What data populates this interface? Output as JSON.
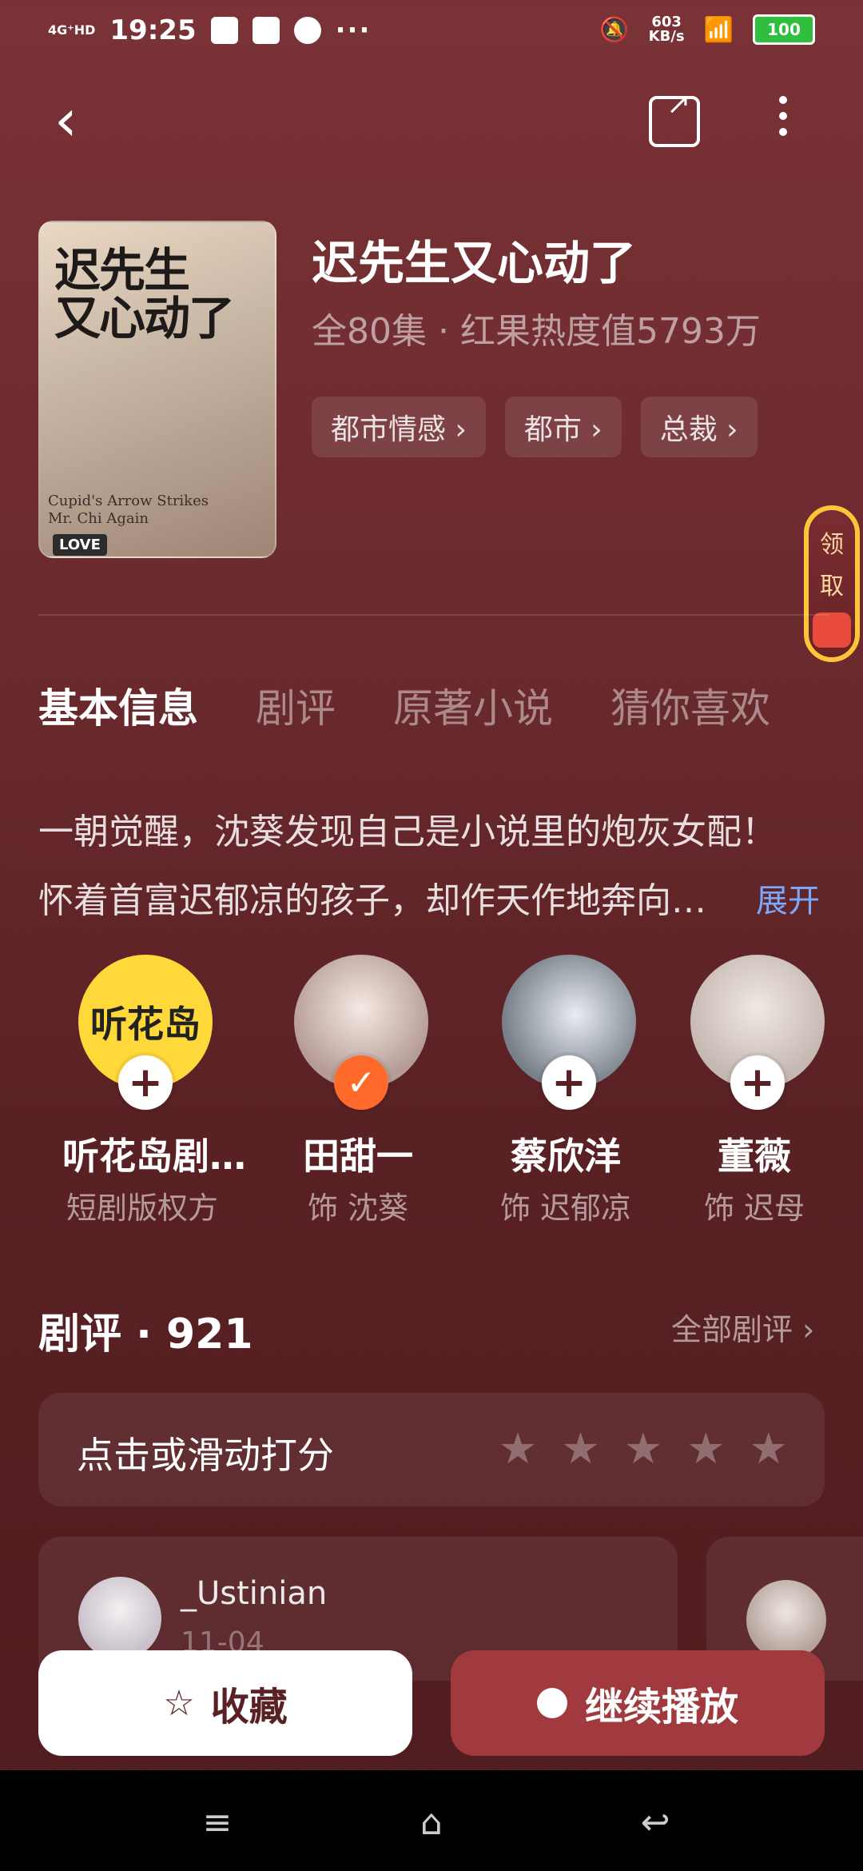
{
  "status_bar": {
    "network": "4G⁺HD",
    "time": "19:25",
    "speed_value": "603",
    "speed_unit": "KB/s",
    "battery": "100"
  },
  "header": {
    "title": "迟先生又心动了",
    "meta": "全80集 · 红果热度值5793万",
    "tags": [
      "都市情感 ›",
      "都市 ›",
      "总裁 ›"
    ],
    "poster": {
      "title_line1": "迟先生",
      "title_line2": "又心动了",
      "en_line1": "Cupid's Arrow Strikes",
      "en_line2": "Mr. Chi Again",
      "love": "LOVE"
    }
  },
  "claim_tab": {
    "line1": "领",
    "line2": "取"
  },
  "tabs": [
    "基本信息",
    "剧评",
    "原著小说",
    "猜你喜欢"
  ],
  "synopsis": {
    "line1": "一朝觉醒，沈葵发现自己是小说里的炮灰女配！",
    "line2": "怀着首富迟郁凉的孩子，却作天作地奔向…",
    "expand": "展开"
  },
  "cast": [
    {
      "name": "听花岛剧…",
      "role": "短剧版权方",
      "logo_text": "听花岛",
      "followed": false
    },
    {
      "name": "田甜一",
      "role": "饰 沈葵",
      "followed": true
    },
    {
      "name": "蔡欣洋",
      "role": "饰 迟郁凉",
      "followed": false
    },
    {
      "name": "董薇",
      "role": "饰 迟母",
      "followed": false
    }
  ],
  "reviews": {
    "title": "剧评 · 921",
    "all_label": "全部剧评 ›",
    "rate_prompt": "点击或滑动打分",
    "first_user": "_Ustinian",
    "first_date": "11-04"
  },
  "bottom": {
    "favorite_label": "收藏",
    "play_label": "继续播放"
  },
  "colors": {
    "background": "#6a2a2e",
    "accent": "#a13a3e",
    "link": "#7aa9ff",
    "check": "#ff6a2a"
  }
}
